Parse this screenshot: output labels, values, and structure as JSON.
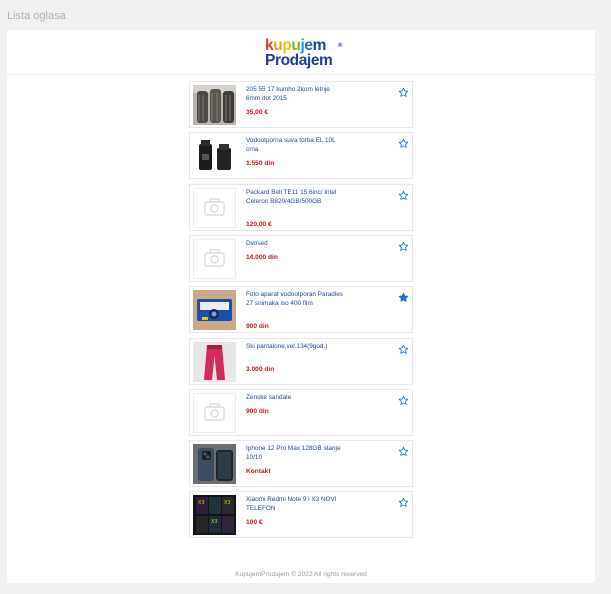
{
  "page": {
    "title": "Lista oglasa"
  },
  "logo": {
    "line1": [
      {
        "ch": "k",
        "color": "#e53b2c"
      },
      {
        "ch": "u",
        "color": "#f29c1f"
      },
      {
        "ch": "p",
        "color": "#f4c21a"
      },
      {
        "ch": "u",
        "color": "#79b733"
      },
      {
        "ch": "j",
        "color": "#1aa0d8"
      },
      {
        "ch": "e",
        "color": "#2b6bb5"
      },
      {
        "ch": "m",
        "color": "#1d3f94"
      }
    ],
    "line2": "Prodajem",
    "registered": "®"
  },
  "listings": [
    {
      "title": "205 55 17 kumho 2kom letnje 6mm dot 2015",
      "price": "35,00 €",
      "image": "tires",
      "favorite": false
    },
    {
      "title": "Vodootporna suva torba EL 10L crna",
      "price": "1.550 din",
      "image": "drybag",
      "favorite": false
    },
    {
      "title": "Packard Bell TE11 15.6inc/ Intel Celeron B820/4GB/500GB",
      "price": "120,00 €",
      "image": "placeholder",
      "favorite": false
    },
    {
      "title": "Dvosed",
      "price": "14.000 din",
      "image": "placeholder",
      "favorite": false
    },
    {
      "title": "Foto aparat vodootporan Paradies 27 snimaka iso 400 film",
      "price": "900 din",
      "image": "camera",
      "favorite": true
    },
    {
      "title": "Ski pantalone,vel.134(9god.)",
      "price": "3.000 din",
      "image": "pants",
      "favorite": false
    },
    {
      "title": "Zenske sandale",
      "price": "900 din",
      "image": "placeholder",
      "favorite": false
    },
    {
      "title": "Iphone 12 Pro Max 128GB stanje 10/10",
      "price": "Kontakt",
      "image": "phone",
      "favorite": false
    },
    {
      "title": "Xiaomi Redmi Note 9 i X3 NOVI TELEFON",
      "price": "100 €",
      "image": "phones",
      "favorite": false
    }
  ],
  "colors": {
    "star": "#1e72c9",
    "price": "#c4161c",
    "title": "#1f4a8a"
  },
  "footer": {
    "text": "KupujemProdajem © 2022 All rights reserved"
  }
}
